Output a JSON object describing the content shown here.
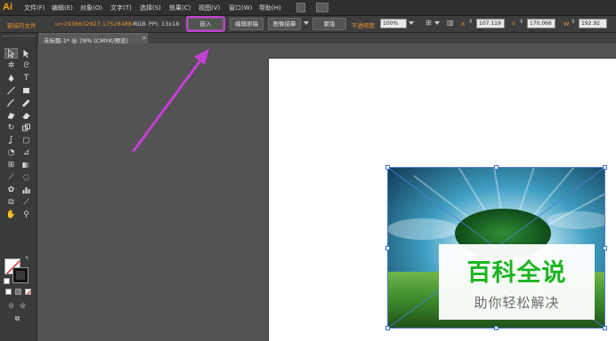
{
  "app": {
    "logo": "Ai",
    "accent_color": "#f7a21b"
  },
  "menu": {
    "items": [
      "文件(F)",
      "编辑(E)",
      "对象(O)",
      "文字(T)",
      "选择(S)",
      "效果(C)",
      "视图(V)",
      "窗口(W)",
      "帮助(H)"
    ]
  },
  "control_bar": {
    "linked_file_label": "链接的文件",
    "filename": "u=1936632927,175284884...",
    "color_mode": "RGB",
    "ppi": "PPI: 13x18",
    "embed_button": "嵌入",
    "edit_original_button": "编辑原稿",
    "image_trace_button": "图像描摹",
    "mask_button": "蒙版",
    "opacity_label": "不透明度",
    "opacity_value": "100%",
    "x_label": "X",
    "x_value": "107.119 m",
    "y_label": "Y",
    "y_value": "170.066 m",
    "w_label": "W",
    "w_value": "192.92 m",
    "highlight_color": "#c43fd6"
  },
  "document_tab": {
    "title": "未标题-1* @ 78% (CMYK/预览)",
    "close": "×"
  },
  "toolbar": {
    "tools": [
      "selection-tool",
      "direct-selection-tool",
      "magic-wand-tool",
      "lasso-tool",
      "pen-tool",
      "type-tool",
      "line-segment-tool",
      "rectangle-tool",
      "paintbrush-tool",
      "pencil-tool",
      "blob-brush-tool",
      "eraser-tool",
      "rotate-tool",
      "scale-tool",
      "warp-tool",
      "free-transform-tool",
      "shape-builder-tool",
      "perspective-grid-tool",
      "mesh-tool",
      "gradient-tool",
      "eyedropper-tool",
      "blend-tool",
      "symbol-sprayer-tool",
      "column-graph-tool",
      "artboard-tool",
      "slice-tool",
      "hand-tool",
      "zoom-tool"
    ]
  },
  "canvas": {
    "zoom": "78%",
    "placed_image": {
      "watermark_title": "百科全说",
      "watermark_subtitle": "助你轻松解决",
      "watermark_title_color": "#1bb520"
    }
  },
  "annotation": {
    "arrow_color": "#c43fd6"
  }
}
